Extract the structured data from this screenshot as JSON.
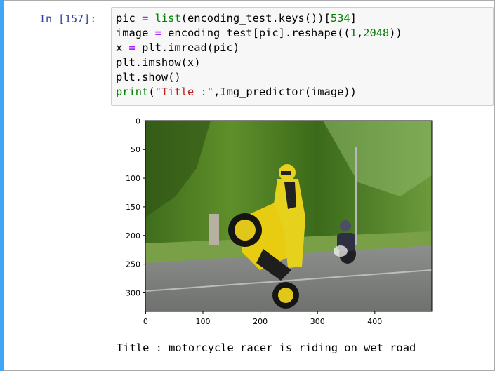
{
  "cell": {
    "prompt": "In [157]:",
    "code_lines": [
      [
        {
          "t": "pic ",
          "c": ""
        },
        {
          "t": "=",
          "c": "op"
        },
        {
          "t": " ",
          "c": ""
        },
        {
          "t": "list",
          "c": "kw"
        },
        {
          "t": "(encoding_test.keys())[",
          "c": ""
        },
        {
          "t": "534",
          "c": "num"
        },
        {
          "t": "]",
          "c": ""
        }
      ],
      [
        {
          "t": "image ",
          "c": ""
        },
        {
          "t": "=",
          "c": "op"
        },
        {
          "t": " encoding_test[pic].reshape((",
          "c": ""
        },
        {
          "t": "1",
          "c": "num"
        },
        {
          "t": ",",
          "c": ""
        },
        {
          "t": "2048",
          "c": "num"
        },
        {
          "t": "))",
          "c": ""
        }
      ],
      [
        {
          "t": "x ",
          "c": ""
        },
        {
          "t": "=",
          "c": "op"
        },
        {
          "t": " plt.imread(pic)",
          "c": ""
        }
      ],
      [
        {
          "t": "plt.imshow(x)",
          "c": ""
        }
      ],
      [
        {
          "t": "plt.show()",
          "c": ""
        }
      ],
      [
        {
          "t": "print",
          "c": "kw"
        },
        {
          "t": "(",
          "c": ""
        },
        {
          "t": "\"Title :\"",
          "c": "str"
        },
        {
          "t": ",Img_predictor(image))",
          "c": ""
        }
      ]
    ]
  },
  "plot": {
    "yticks": [
      "0",
      "50",
      "100",
      "150",
      "200",
      "250",
      "300"
    ],
    "xticks": [
      "0",
      "100",
      "200",
      "300",
      "400"
    ],
    "image_alt": "motorcycle racer doing a wheelie on a road"
  },
  "output": {
    "text": "Title : motorcycle racer is riding on wet road"
  },
  "colors": {
    "cell_bar": "#42A5F5",
    "prompt": "#303F9F",
    "keyword": "#008000",
    "operator": "#AA22FF",
    "string": "#BA2121"
  }
}
